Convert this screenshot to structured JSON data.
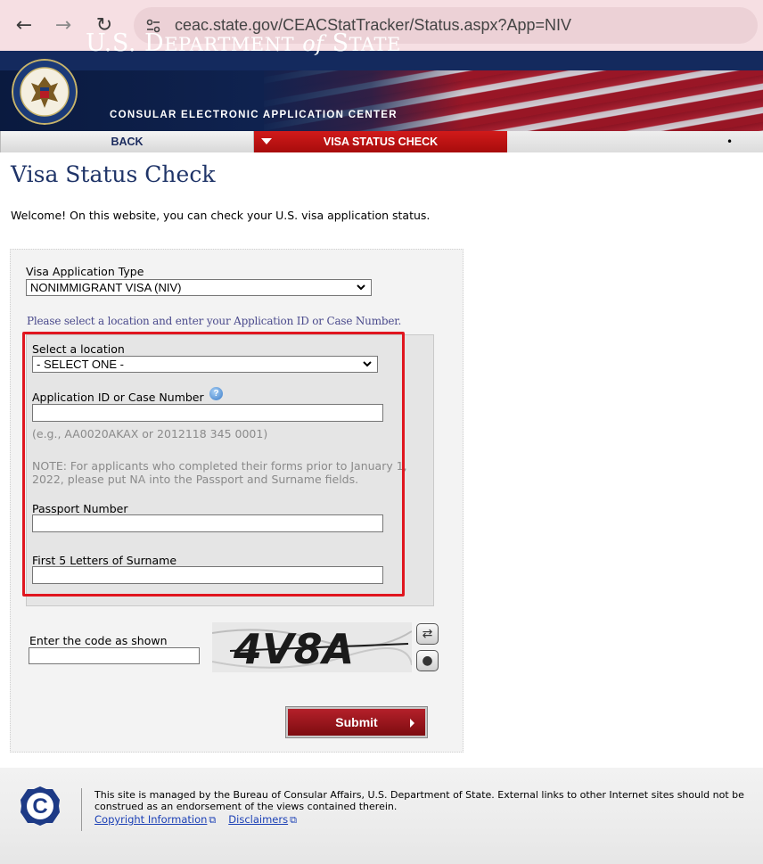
{
  "browser": {
    "url": "ceac.state.gov/CEACStatTracker/Status.aspx?App=NIV",
    "back_icon": "←",
    "forward_icon": "→",
    "reload_icon": "↻"
  },
  "header": {
    "dept_us": "U.S. D",
    "dept_epartment": "EPARTMENT",
    "dept_of": "of",
    "dept_s": "S",
    "dept_tate": "TATE",
    "subtitle": "CONSULAR ELECTRONIC APPLICATION CENTER"
  },
  "nav": {
    "back": "BACK",
    "active": "VISA STATUS CHECK",
    "dot": "•"
  },
  "page": {
    "title": "Visa Status Check",
    "welcome": "Welcome! On this website, you can check your U.S. visa application status."
  },
  "form": {
    "app_type_label": "Visa Application Type",
    "app_type_value": "NONIMMIGRANT VISA (NIV)",
    "instructions": "Please select a location and enter your Application ID or Case Number.",
    "location_label": "Select a location",
    "location_value": "- SELECT ONE -",
    "app_id_label": "Application ID or Case Number",
    "help_glyph": "?",
    "app_id_example": "(e.g., AA0020AKAX or 2012118 345 0001)",
    "note": "NOTE: For applicants who completed their forms prior to January 1, 2022, please put NA into the Passport and Surname fields.",
    "passport_label": "Passport Number",
    "surname_label": "First 5 Letters of Surname",
    "captcha_label": "Enter the code as shown",
    "captcha_text": "4V8A",
    "refresh_glyph": "⇄",
    "audio_glyph": "●",
    "submit_label": "Submit"
  },
  "footer": {
    "logo_letter": "C",
    "text": "This site is managed by the Bureau of Consular Affairs, U.S. Department of State. External links to other Internet sites should not be construed as an endorsement of the views contained therein.",
    "link_copyright": "Copyright Information",
    "link_disclaimers": "Disclaimers",
    "ext_icon": "⧉"
  },
  "colors": {
    "nav_active": "#c01414",
    "title_blue": "#1f3468",
    "highlight_red": "#e0161f",
    "submit_red": "#9a141c"
  }
}
